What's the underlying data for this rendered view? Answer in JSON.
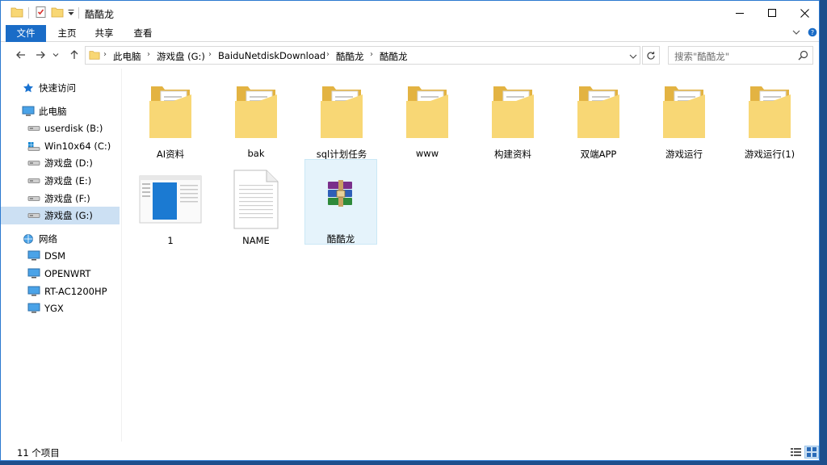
{
  "window": {
    "title": "酷酷龙"
  },
  "ribbon": {
    "tabs": [
      "文件",
      "主页",
      "共享",
      "查看"
    ]
  },
  "address": {
    "crumbs": [
      "此电脑",
      "游戏盘 (G:)",
      "BaiduNetdiskDownload",
      "酷酷龙",
      "酷酷龙"
    ],
    "search_placeholder": "搜索\"酷酷龙\""
  },
  "sidebar": {
    "items": [
      {
        "label": "快速访问",
        "icon": "star-icon"
      },
      {
        "label": "此电脑",
        "icon": "computer-icon"
      },
      {
        "label": "userdisk (B:)",
        "icon": "drive-icon"
      },
      {
        "label": "Win10x64 (C:)",
        "icon": "system-drive-icon"
      },
      {
        "label": "游戏盘 (D:)",
        "icon": "drive-icon"
      },
      {
        "label": "游戏盘 (E:)",
        "icon": "drive-icon"
      },
      {
        "label": "游戏盘 (F:)",
        "icon": "drive-icon"
      },
      {
        "label": "游戏盘 (G:)",
        "icon": "drive-icon"
      },
      {
        "label": "网络",
        "icon": "network-icon"
      },
      {
        "label": "DSM",
        "icon": "monitor-icon"
      },
      {
        "label": "OPENWRT",
        "icon": "monitor-icon"
      },
      {
        "label": "RT-AC1200HP",
        "icon": "monitor-icon"
      },
      {
        "label": "YGX",
        "icon": "monitor-icon"
      }
    ]
  },
  "files": [
    {
      "name": "AI资料",
      "type": "folder"
    },
    {
      "name": "bak",
      "type": "folder"
    },
    {
      "name": "sql计划任务",
      "type": "folder"
    },
    {
      "name": "www",
      "type": "folder"
    },
    {
      "name": "构建资料",
      "type": "folder"
    },
    {
      "name": "双端APP",
      "type": "folder"
    },
    {
      "name": "游戏运行",
      "type": "folder"
    },
    {
      "name": "游戏运行(1)",
      "type": "folder"
    },
    {
      "name": "1",
      "type": "image"
    },
    {
      "name": "NAME",
      "type": "text-file"
    },
    {
      "name": "酷酷龙",
      "type": "archive"
    }
  ],
  "status": {
    "item_count": "11 个项目"
  },
  "colors": {
    "accent": "#1a6cc7",
    "selection": "#cce0f3",
    "folder": "#f8d775"
  }
}
